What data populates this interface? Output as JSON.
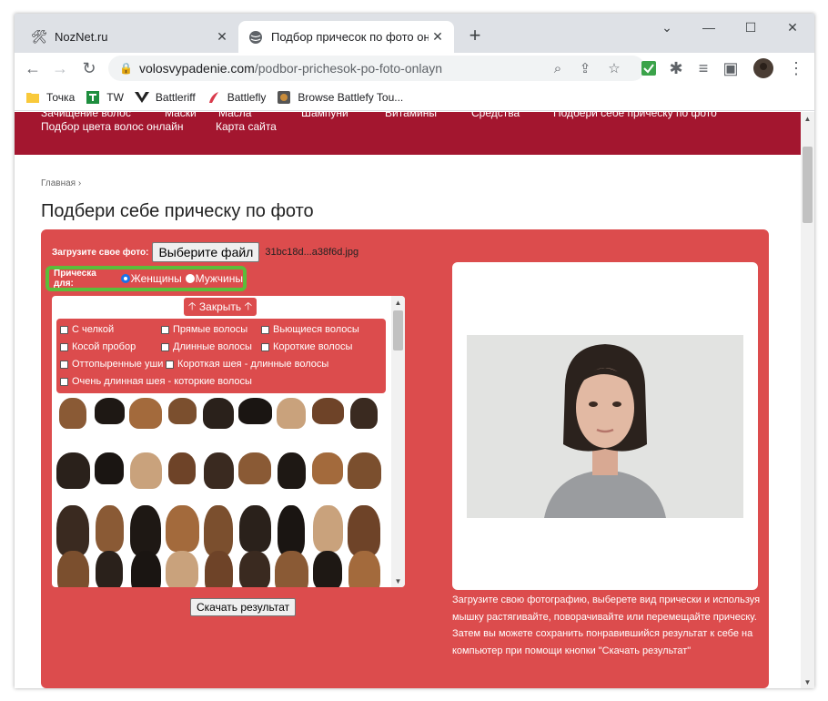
{
  "browser": {
    "tabs": [
      {
        "title": "NozNet.ru",
        "icon": "tools-icon"
      },
      {
        "title": "Подбор причесок по фото онла",
        "icon": "globe-icon"
      }
    ],
    "url_host": "volosvypadenie.com",
    "url_path": "/podbor-prichesok-po-foto-onlayn",
    "bookmarks": [
      {
        "label": "Точка",
        "icon": "folder-icon"
      },
      {
        "label": "TW",
        "icon": "tw-icon"
      },
      {
        "label": "Battleriff",
        "icon": "battleriff-icon"
      },
      {
        "label": "Battlefly",
        "icon": "battlefly-icon"
      },
      {
        "label": "Browse Battlefy Tou...",
        "icon": "battlefy-icon"
      }
    ]
  },
  "nav": {
    "cut_items": [
      "Зачищение волос",
      "Маски",
      "Масла",
      "Шампуни",
      "Витамины",
      "Средства",
      "Подбери себе прическу по фото"
    ],
    "items": [
      "Подбор цвета волос онлайн",
      "Карта сайта"
    ]
  },
  "breadcrumb": "Главная",
  "page_title": "Подбери себе прическу по фото",
  "upload": {
    "label": "Загрузите свое фото:",
    "button": "Выберите файл",
    "filename": "31bc18d...a38f6d.jpg"
  },
  "gender": {
    "label": "Прическа для:",
    "options": [
      "Женщины",
      "Мужчины"
    ],
    "selected": "Женщины"
  },
  "close_button": "Закрыть",
  "filters": [
    "С челкой",
    "Прямые волосы",
    "Вьющиеся волосы",
    "Косой пробор",
    "Длинные волосы",
    "Короткие волосы",
    "Оттопыренные уши",
    "Короткая шея - длинные волосы",
    "Очень длинная шея - которкие волосы"
  ],
  "download_button": "Скачать результат",
  "description": "Загрузите свою фотографию, выберете вид прически и используя мышку растягивайте, поворачивайте или перемещайте прическу. Затем вы можете сохранить понравившийся результат к себе на компьютер при помощи кнопки \"Скачать результат\"",
  "colors": {
    "nav_bg": "#a3162f",
    "panel_bg": "#dc4c4d",
    "highlight": "#5bbd3a"
  }
}
